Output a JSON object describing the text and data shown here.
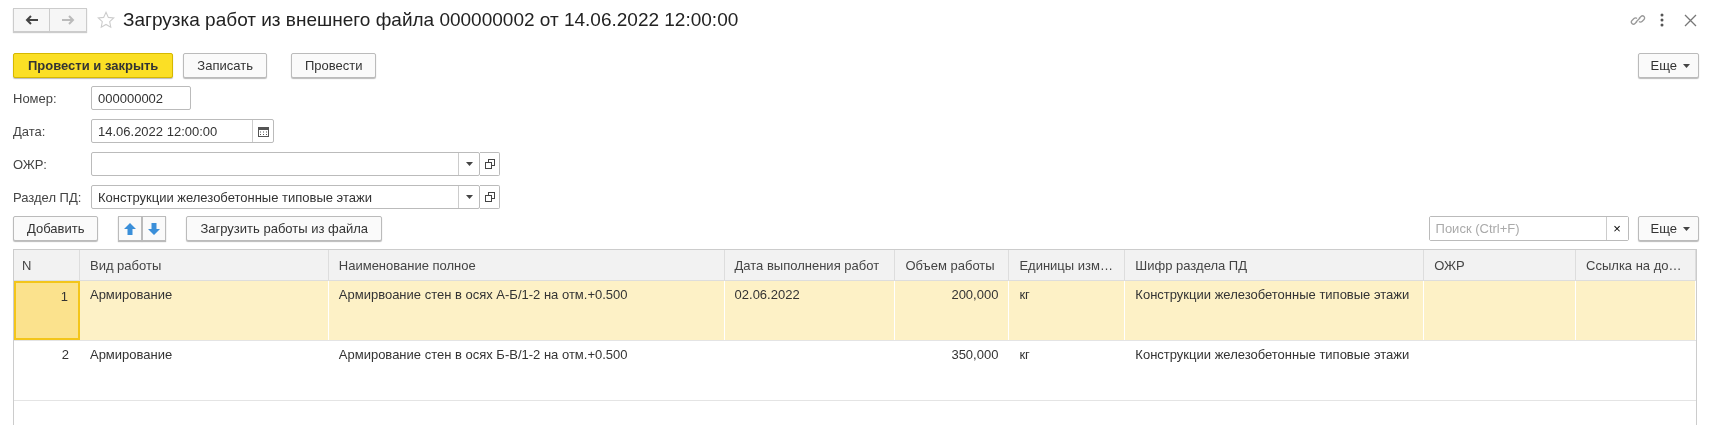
{
  "window": {
    "title": "Загрузка работ из внешнего файла 000000002 от 14.06.2022 12:00:00"
  },
  "command_bar": {
    "buttons": [
      {
        "label": "Провести и закрыть",
        "kind": "primary"
      },
      {
        "label": "Записать",
        "kind": "normal"
      },
      {
        "label": "Провести",
        "kind": "spaced"
      }
    ],
    "more": "Еще"
  },
  "fields": [
    {
      "label": "Номер:",
      "kind": "text",
      "value": "000000002"
    },
    {
      "label": "Дата:",
      "kind": "date",
      "value": "14.06.2022 12:00:00"
    },
    {
      "label": "ОЖР:",
      "kind": "select"
    },
    {
      "label": "Раздел ПД:",
      "kind": "select",
      "value": "Конструкции железобетонные типовые этажи"
    }
  ],
  "table_bar": {
    "add": "Добавить",
    "load": "Загрузить работы из файла",
    "search": {
      "placeholder": "Поиск (Ctrl+F)",
      "clear": "×"
    },
    "more": "Еще"
  },
  "table": {
    "columns": [
      {
        "label": "N",
        "kind": "number"
      },
      {
        "label": "Вид работы",
        "kind": "text"
      },
      {
        "label": "Наименование полное",
        "kind": "text"
      },
      {
        "label": "Дата выполнения работ",
        "kind": "text"
      },
      {
        "label": "Объем работы",
        "kind": "number"
      },
      {
        "label": "Единицы изм…",
        "kind": "text"
      },
      {
        "label": "Шифр раздела ПД",
        "kind": "text"
      },
      {
        "label": "ОЖР",
        "kind": "text"
      },
      {
        "label": "Ссылка на до…",
        "kind": "text"
      }
    ],
    "rows": [
      {
        "selected": true,
        "cells": [
          "1",
          "Армирование",
          "Армирвоание стен в осях А-Б/1-2 на отм.+0.500",
          "02.06.2022",
          "200,000",
          "кг",
          "Конструкции железобетонные типовые этажи",
          "",
          ""
        ]
      },
      {
        "selected": false,
        "cells": [
          "2",
          "Армирование",
          "Армирование стен в осях Б-В/1-2 на отм.+0.500",
          "",
          "350,000",
          "кг",
          "Конструкции железобетонные типовые этажи",
          "",
          ""
        ]
      }
    ]
  }
}
